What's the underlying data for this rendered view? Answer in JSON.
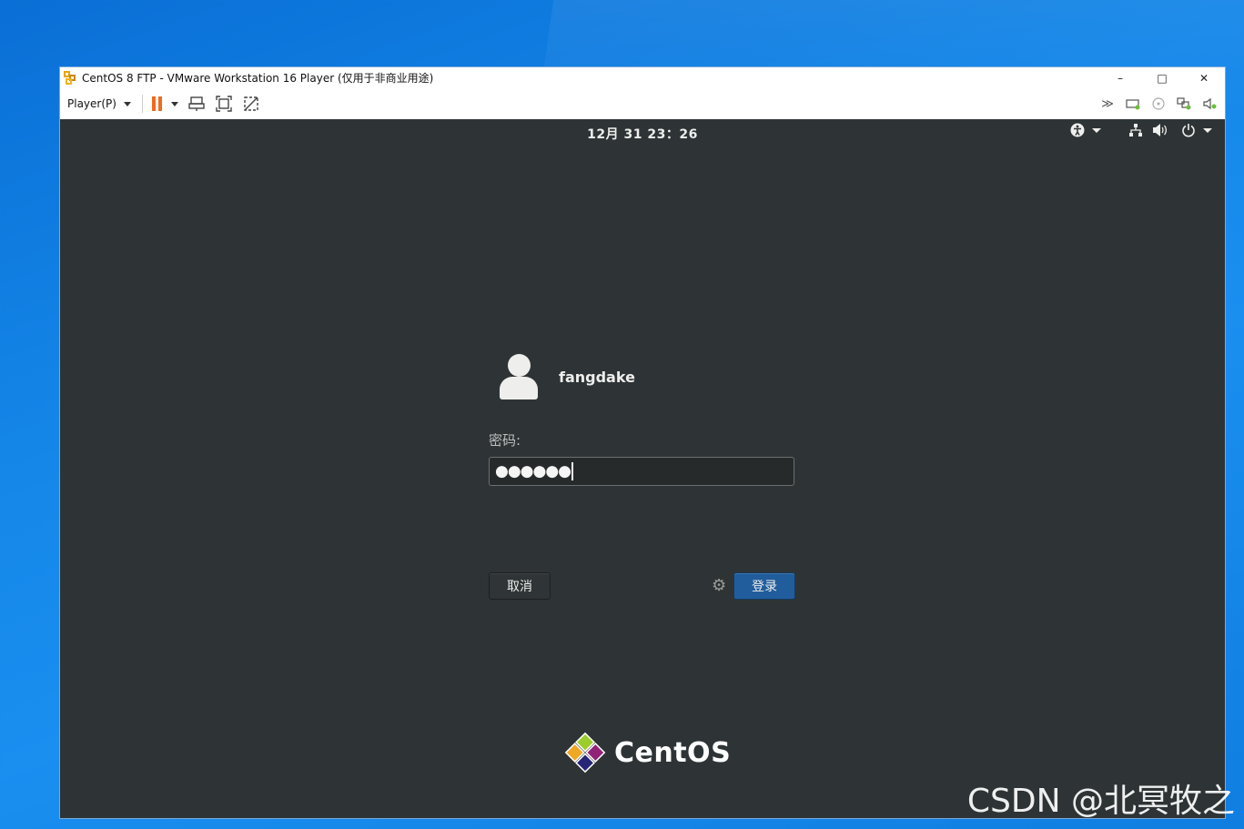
{
  "window": {
    "title": "CentOS 8 FTP - VMware Workstation 16 Player (仅用于非商业用途)",
    "controls": {
      "minimize": "–",
      "maximize": "□",
      "close": "✕"
    }
  },
  "toolbar": {
    "player_menu": "Player(P)",
    "left_icons": [
      "pause-icon",
      "send-ctrl-alt-del-icon",
      "fullscreen-icon",
      "unity-icon"
    ],
    "right_icons": [
      "more-icon",
      "hard-disk-icon",
      "cd-dvd-icon",
      "network-adapter-icon",
      "sound-icon"
    ]
  },
  "gnome": {
    "clock": "12月 31  23：26",
    "panel_icons": [
      "accessibility-icon",
      "network-icon",
      "volume-icon",
      "power-icon"
    ]
  },
  "login": {
    "username": "fangdake",
    "password_label": "密码:",
    "password_value": "●●●●●●",
    "cancel_label": "取消",
    "login_label": "登录"
  },
  "brand": {
    "logo_text": "CentOS"
  },
  "watermark": "CSDN @北冥牧之",
  "colors": {
    "vm_background": "#2e3436",
    "login_button": "#215d9c",
    "pause_accent": "#f06a1f",
    "desktop": "#1486e8"
  }
}
